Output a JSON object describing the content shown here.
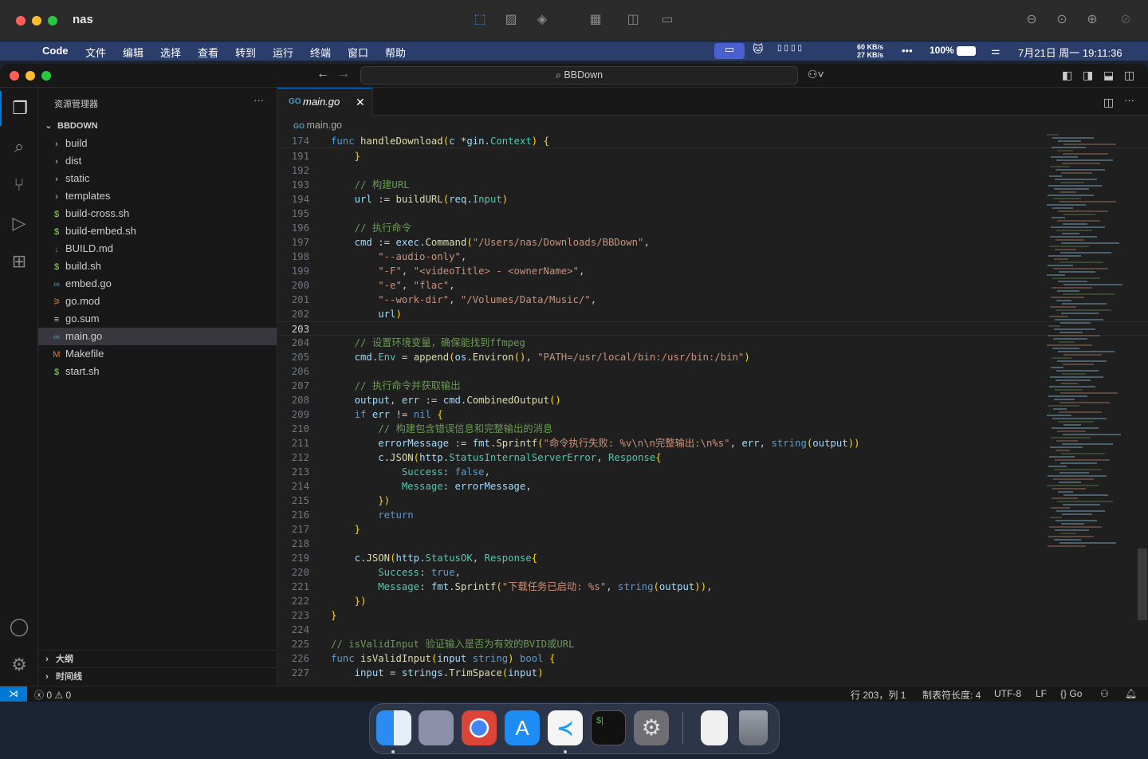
{
  "outer_window": {
    "title": "nas"
  },
  "menubar": {
    "app": "Code",
    "items": [
      "文件",
      "编辑",
      "选择",
      "查看",
      "转到",
      "运行",
      "终端",
      "窗口",
      "帮助"
    ],
    "net_up": "60 KB/s",
    "net_down": "27 KB/s",
    "more": "•••",
    "battery": "100%",
    "datetime": "7月21日 周一  19:11:36"
  },
  "titlebar": {
    "search": "BBDown"
  },
  "sidebar": {
    "header": "资源管理器",
    "more": "···",
    "root": "BBDOWN",
    "items": [
      {
        "label": "build",
        "icon": "›",
        "type": "folder"
      },
      {
        "label": "dist",
        "icon": "›",
        "type": "folder"
      },
      {
        "label": "static",
        "icon": "›",
        "type": "folder"
      },
      {
        "label": "templates",
        "icon": "›",
        "type": "folder"
      },
      {
        "label": "build-cross.sh",
        "icon": "$",
        "type": "shell"
      },
      {
        "label": "build-embed.sh",
        "icon": "$",
        "type": "shell"
      },
      {
        "label": "BUILD.md",
        "icon": "↓",
        "type": "markdown"
      },
      {
        "label": "build.sh",
        "icon": "$",
        "type": "shell"
      },
      {
        "label": "embed.go",
        "icon": "∞",
        "type": "go"
      },
      {
        "label": "go.mod",
        "icon": "⚞",
        "type": "gomod"
      },
      {
        "label": "go.sum",
        "icon": "≡",
        "type": "gosum"
      },
      {
        "label": "main.go",
        "icon": "∞",
        "type": "go"
      },
      {
        "label": "Makefile",
        "icon": "M",
        "type": "make"
      },
      {
        "label": "start.sh",
        "icon": "$",
        "type": "shell"
      }
    ],
    "outline": "大纲",
    "timeline": "时间线"
  },
  "editor": {
    "tab": "main.go",
    "breadcrumb": "main.go",
    "sticky": {
      "num": "174",
      "text": "func handleDownload(c *gin.Context) {"
    },
    "lines": [
      {
        "n": "191",
        "t": "    }"
      },
      {
        "n": "192",
        "t": ""
      },
      {
        "n": "193",
        "t": "    // 构建URL"
      },
      {
        "n": "194",
        "t": "    url := buildURL(req.Input)"
      },
      {
        "n": "195",
        "t": ""
      },
      {
        "n": "196",
        "t": "    // 执行命令"
      },
      {
        "n": "197",
        "t": "    cmd := exec.Command(\"/Users/nas/Downloads/BBDown\","
      },
      {
        "n": "198",
        "t": "        \"--audio-only\","
      },
      {
        "n": "199",
        "t": "        \"-F\", \"<videoTitle> - <ownerName>\","
      },
      {
        "n": "200",
        "t": "        \"-e\", \"flac\","
      },
      {
        "n": "201",
        "t": "        \"--work-dir\", \"/Volumes/Data/Music/\","
      },
      {
        "n": "202",
        "t": "        url)"
      },
      {
        "n": "203",
        "t": ""
      },
      {
        "n": "204",
        "t": "    // 设置环境变量，确保能找到ffmpeg"
      },
      {
        "n": "205",
        "t": "    cmd.Env = append(os.Environ(), \"PATH=/usr/local/bin:/usr/bin:/bin\")"
      },
      {
        "n": "206",
        "t": ""
      },
      {
        "n": "207",
        "t": "    // 执行命令并获取输出"
      },
      {
        "n": "208",
        "t": "    output, err := cmd.CombinedOutput()"
      },
      {
        "n": "209",
        "t": "    if err != nil {"
      },
      {
        "n": "210",
        "t": "        // 构建包含错误信息和完整输出的消息"
      },
      {
        "n": "211",
        "t": "        errorMessage := fmt.Sprintf(\"命令执行失败: %v\\n\\n完整输出:\\n%s\", err, string(output))"
      },
      {
        "n": "212",
        "t": "        c.JSON(http.StatusInternalServerError, Response{"
      },
      {
        "n": "213",
        "t": "            Success: false,"
      },
      {
        "n": "214",
        "t": "            Message: errorMessage,"
      },
      {
        "n": "215",
        "t": "        })"
      },
      {
        "n": "216",
        "t": "        return"
      },
      {
        "n": "217",
        "t": "    }"
      },
      {
        "n": "218",
        "t": ""
      },
      {
        "n": "219",
        "t": "    c.JSON(http.StatusOK, Response{"
      },
      {
        "n": "220",
        "t": "        Success: true,"
      },
      {
        "n": "221",
        "t": "        Message: fmt.Sprintf(\"下载任务已启动: %s\", string(output)),"
      },
      {
        "n": "222",
        "t": "    })"
      },
      {
        "n": "223",
        "t": "}"
      },
      {
        "n": "224",
        "t": ""
      },
      {
        "n": "225",
        "t": "// isValidInput 验证输入是否为有效的BVID或URL"
      },
      {
        "n": "226",
        "t": "func isValidInput(input string) bool {"
      },
      {
        "n": "227",
        "t": "    input = strings.TrimSpace(input)"
      }
    ]
  },
  "statusbar": {
    "errors": "0",
    "warnings": "0",
    "position": "行 203，列 1",
    "tab_size": "制表符长度: 4",
    "encoding": "UTF-8",
    "eol": "LF",
    "language": "Go"
  },
  "dock": [
    "Finder",
    "Launchpad",
    "Chrome",
    "App Store",
    "Visual Studio Code",
    "Terminal",
    "System Settings",
    "Document",
    "Trash"
  ]
}
